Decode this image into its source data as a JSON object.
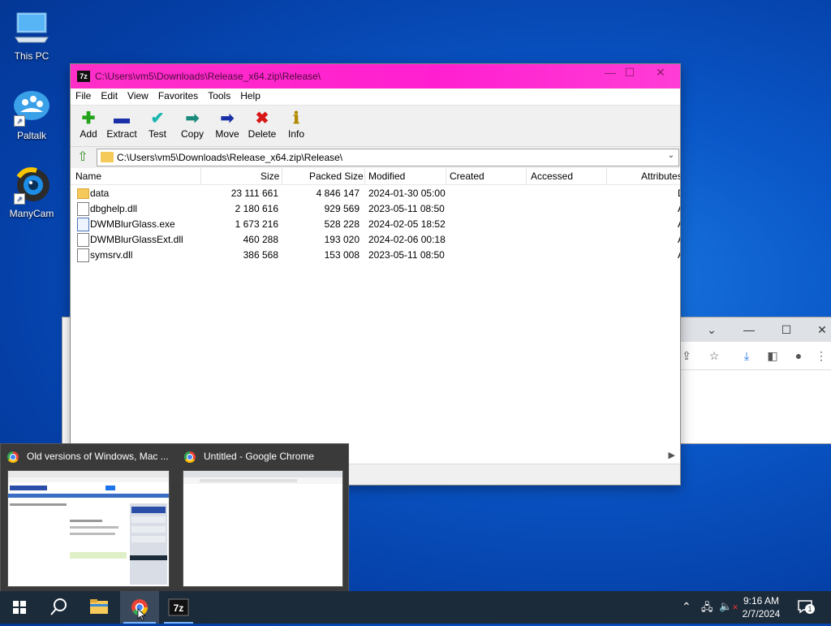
{
  "desktop": {
    "icons": [
      {
        "label": "This PC"
      },
      {
        "label": "Paltalk"
      },
      {
        "label": "ManyCam"
      }
    ]
  },
  "zip": {
    "title": "C:\\Users\\vm5\\Downloads\\Release_x64.zip\\Release\\",
    "app_icon_text": "7z",
    "menu": [
      "File",
      "Edit",
      "View",
      "Favorites",
      "Tools",
      "Help"
    ],
    "toolbar": [
      {
        "label": "Add",
        "icon": "plus-icon"
      },
      {
        "label": "Extract",
        "icon": "minus-icon"
      },
      {
        "label": "Test",
        "icon": "check-icon"
      },
      {
        "label": "Copy",
        "icon": "arrow-right-icon"
      },
      {
        "label": "Move",
        "icon": "arrow-right-icon"
      },
      {
        "label": "Delete",
        "icon": "x-icon"
      },
      {
        "label": "Info",
        "icon": "info-icon"
      }
    ],
    "address": "C:\\Users\\vm5\\Downloads\\Release_x64.zip\\Release\\",
    "columns": [
      "Name",
      "Size",
      "Packed Size",
      "Modified",
      "Created",
      "Accessed",
      "Attributes"
    ],
    "rows": [
      {
        "name": "data",
        "type": "folder",
        "size": "23 111 661",
        "packed": "4 846 147",
        "modified": "2024-01-30 05:00",
        "created": "",
        "accessed": "",
        "attr": "D"
      },
      {
        "name": "dbghelp.dll",
        "type": "dll",
        "size": "2 180 616",
        "packed": "929 569",
        "modified": "2023-05-11 08:50",
        "created": "",
        "accessed": "",
        "attr": "A"
      },
      {
        "name": "DWMBlurGlass.exe",
        "type": "exe",
        "size": "1 673 216",
        "packed": "528 228",
        "modified": "2024-02-05 18:52",
        "created": "",
        "accessed": "",
        "attr": "A"
      },
      {
        "name": "DWMBlurGlassExt.dll",
        "type": "dll",
        "size": "460 288",
        "packed": "193 020",
        "modified": "2024-02-06 00:18",
        "created": "",
        "accessed": "",
        "attr": "A"
      },
      {
        "name": "symsrv.dll",
        "type": "dll",
        "size": "386 568",
        "packed": "153 008",
        "modified": "2023-05-11 08:50",
        "created": "",
        "accessed": "",
        "attr": "A"
      }
    ]
  },
  "previews": [
    {
      "title": "Old versions of Windows, Mac ..."
    },
    {
      "title": "Untitled - Google Chrome"
    }
  ],
  "tray": {
    "time": "9:16 AM",
    "date": "2/7/2024",
    "notifications": "1"
  },
  "colors": {
    "titlebar": "#ff2fc8",
    "taskbar": "#1c2b3a",
    "desktop": "#0a57c8"
  }
}
